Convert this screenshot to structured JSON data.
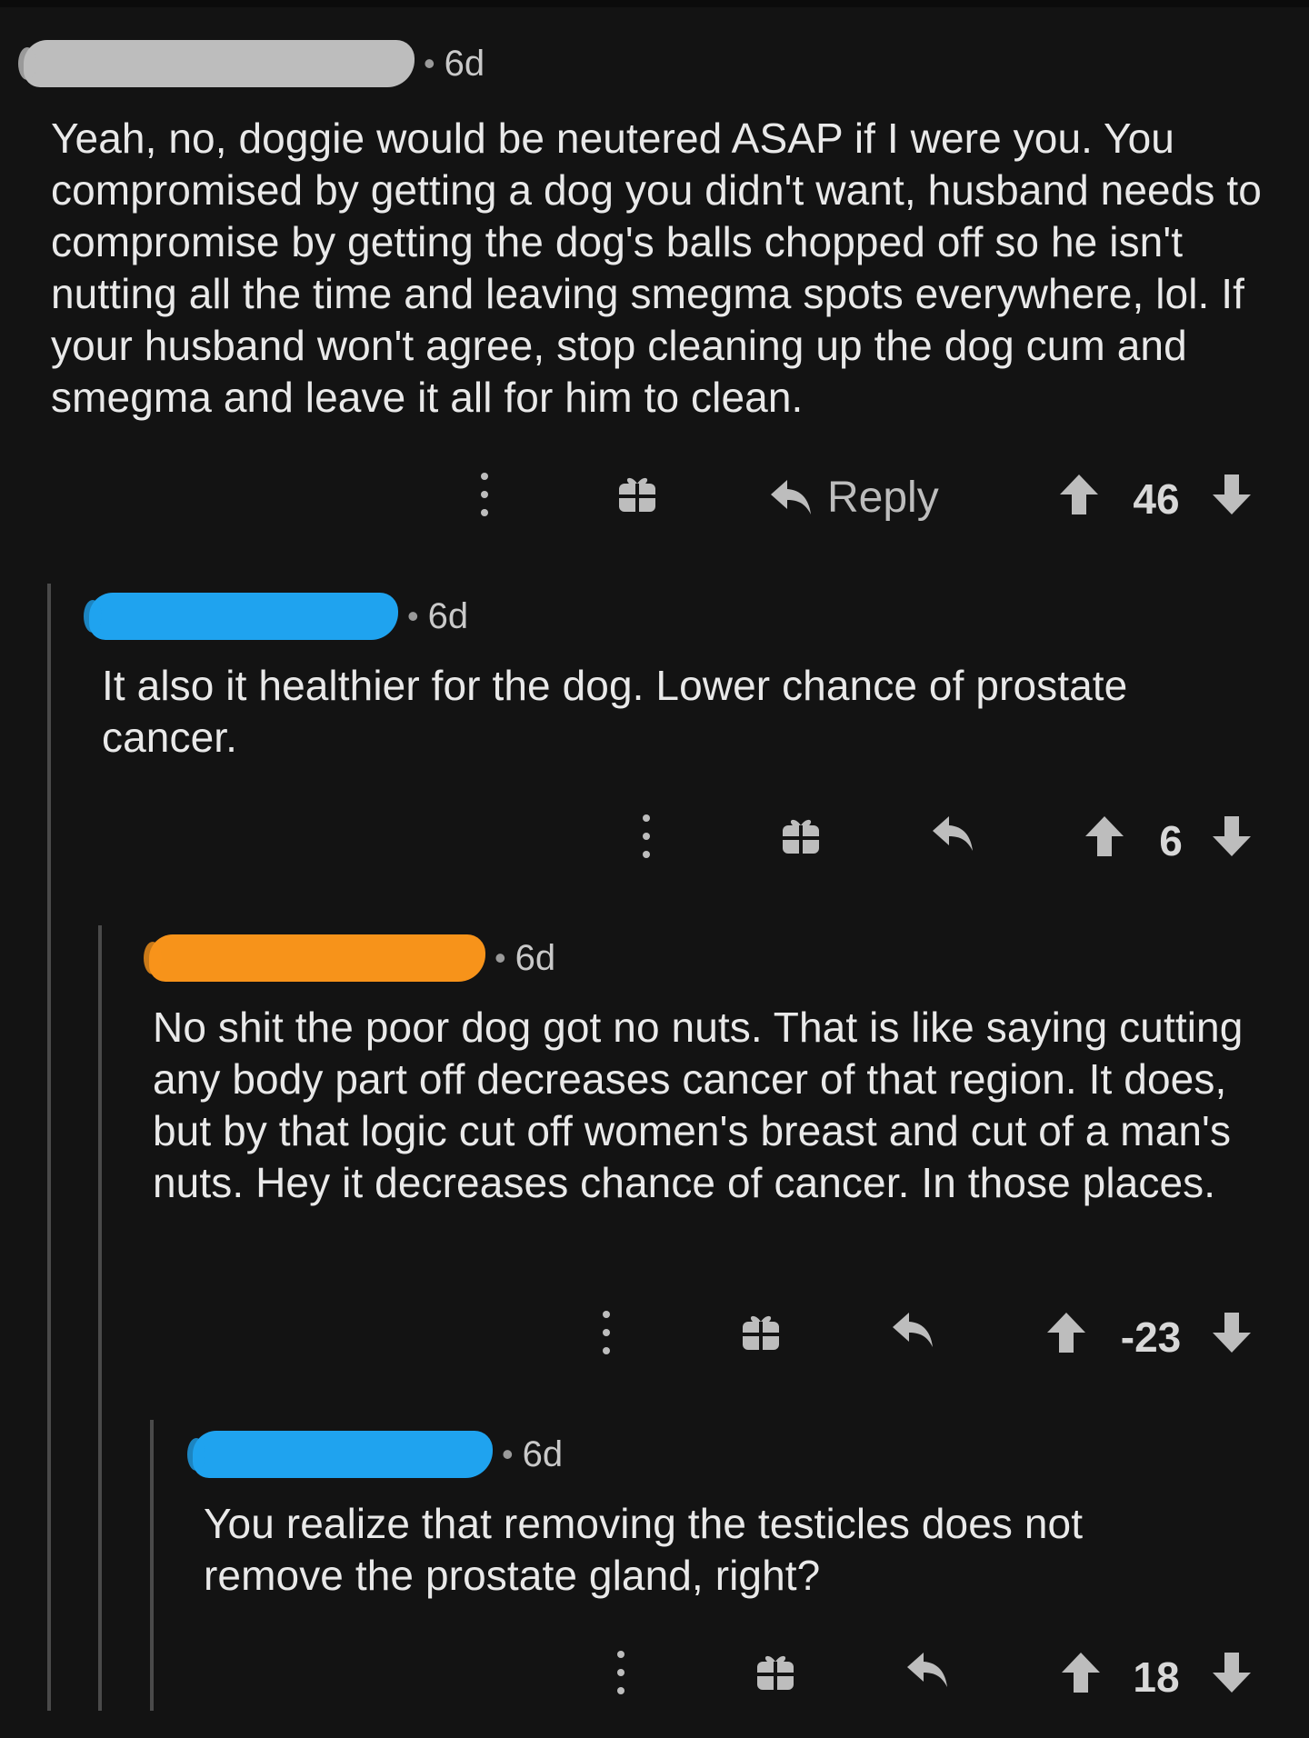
{
  "colors": {
    "background": "#131313",
    "text": "#e9e9e9",
    "icon": "#bdbdbd",
    "thread_line": "#4a4a4a",
    "redact_gray": "#bdbdbd",
    "redact_blue": "#1fa3ef",
    "redact_orange": "#f7931a"
  },
  "comments": [
    {
      "time": "6d",
      "separator": "•",
      "body": "Yeah, no, doggie would be neutered ASAP if I were you. You compromised by getting a dog you didn't want, husband needs to compromise by getting the dog's balls chopped off so he isn't nutting all the time and leaving smegma spots everywhere, lol. If your husband won't agree, stop cleaning up the dog cum and smegma and leave it all for him to clean.",
      "reply_label": "Reply",
      "score": "46",
      "icons": [
        "more-icon",
        "gift-icon",
        "reply-icon",
        "upvote-icon",
        "downvote-icon"
      ]
    },
    {
      "time": "6d",
      "separator": "•",
      "body": "It also it healthier for the dog. Lower chance of prostate cancer.",
      "score": "6",
      "icons": [
        "more-icon",
        "gift-icon",
        "reply-icon",
        "upvote-icon",
        "downvote-icon"
      ]
    },
    {
      "time": "6d",
      "separator": "•",
      "body": "No shit the poor dog got no nuts. That is like saying cutting any body part off decreases cancer of that region. It does, but by that logic cut off women's breast and cut of a man's nuts. Hey it decreases chance of cancer. In those places.",
      "score": "-23",
      "icons": [
        "more-icon",
        "gift-icon",
        "reply-icon",
        "upvote-icon",
        "downvote-icon"
      ]
    },
    {
      "time": "6d",
      "separator": "•",
      "body": "You realize that removing the testicles does not remove the prostate gland, right?",
      "score": "18",
      "icons": [
        "more-icon",
        "gift-icon",
        "reply-icon",
        "upvote-icon",
        "downvote-icon"
      ]
    }
  ]
}
